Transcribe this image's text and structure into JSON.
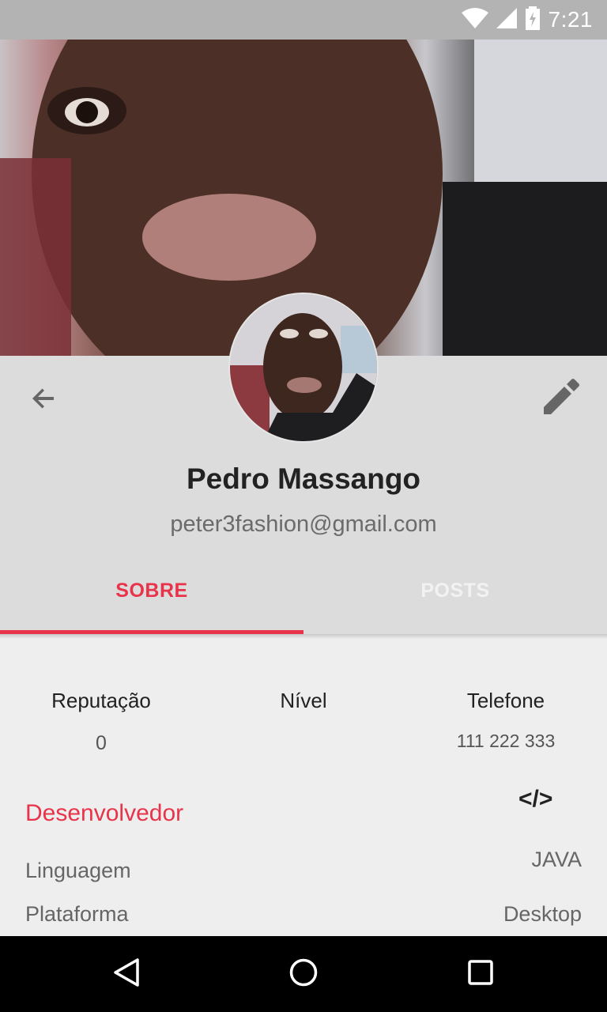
{
  "status_bar": {
    "time": "7:21",
    "icons": [
      "wifi-icon",
      "signal-icon",
      "battery-charging-icon"
    ]
  },
  "colors": {
    "accent": "#e8344a",
    "header_bg": "#dcdcdc",
    "status_bar_bg": "#b3b3b3",
    "content_bg": "#eeeeee"
  },
  "toolbar": {
    "back_icon": "arrow-back-icon",
    "edit_icon": "pencil-icon"
  },
  "profile": {
    "name": "Pedro Massango",
    "email": "peter3fashion@gmail.com"
  },
  "tabs": [
    {
      "label": "SOBRE",
      "active": true
    },
    {
      "label": "POSTS",
      "active": false
    }
  ],
  "stats": {
    "reputation": {
      "label": "Reputação",
      "value": "0"
    },
    "level": {
      "label": "Nível",
      "value": ""
    },
    "phone": {
      "label": "Telefone",
      "value": "111 222 333"
    }
  },
  "developer": {
    "title": "Desenvolvedor",
    "icon": "code-icon",
    "code_glyph": "</>",
    "rows": [
      {
        "label": "Linguagem",
        "value": "JAVA"
      },
      {
        "label": "Plataforma",
        "value": "Desktop"
      }
    ]
  },
  "nav_bar": {
    "icons": [
      "nav-back-icon",
      "nav-home-icon",
      "nav-recents-icon"
    ]
  }
}
